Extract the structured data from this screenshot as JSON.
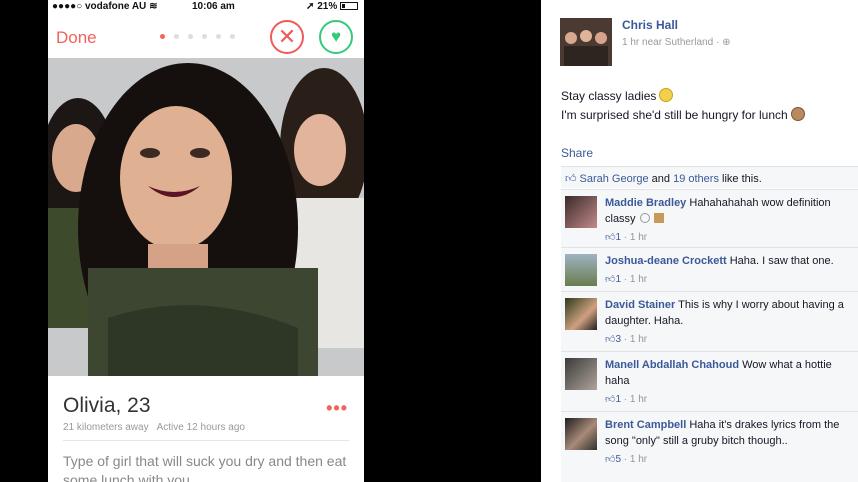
{
  "tinder": {
    "status": {
      "carrier": "●●●●○ vodafone AU",
      "wifi_icon": "wifi-icon",
      "time": "10:06 am",
      "battery": "21%",
      "location_icon": "location-arrow-icon"
    },
    "nav": {
      "done_label": "Done",
      "nope_icon": "✕",
      "like_icon": "♥",
      "photo_count": 6,
      "active_photo": 1
    },
    "profile": {
      "name_age": "Olivia, 23",
      "distance": "21 kilometers away",
      "active": "Active 12 hours ago",
      "bio": "Type of girl that will suck you dry and then eat some lunch with you"
    },
    "colors": {
      "accent": "#f0645a",
      "nope": "#f05a5a",
      "like": "#35c97a"
    }
  },
  "facebook": {
    "post": {
      "author": "Chris Hall",
      "meta": "1 hr near Sutherland · ",
      "line1": "Stay classy ladies",
      "line2": "I'm surprised she'd still be hungry for lunch",
      "share_label": "Share"
    },
    "likes": {
      "first": "Sarah George",
      "and": " and ",
      "others": "19 others",
      "suffix": " like this."
    },
    "comments": [
      {
        "author": "Maddie Bradley",
        "text": "Hahahahahah wow definition classy",
        "likes": "1",
        "time": "1 hr"
      },
      {
        "author": "Joshua-deane Crockett",
        "text": "Haha. I saw that one.",
        "likes": "1",
        "time": "1 hr"
      },
      {
        "author": "David Stainer",
        "text": "This is why I worry about having a daughter. Haha.",
        "likes": "3",
        "time": "1 hr"
      },
      {
        "author": "Manell Abdallah Chahoud",
        "text": "Wow what a hottie haha",
        "likes": "1",
        "time": "1 hr"
      },
      {
        "author": "Brent Campbell",
        "text": "Haha it's drakes lyrics from the song \"only\" still a gruby bitch though..",
        "likes": "5",
        "time": "1 hr"
      }
    ],
    "colors": {
      "link": "#3b5998",
      "comment_bg": "#f6f7f9"
    }
  }
}
